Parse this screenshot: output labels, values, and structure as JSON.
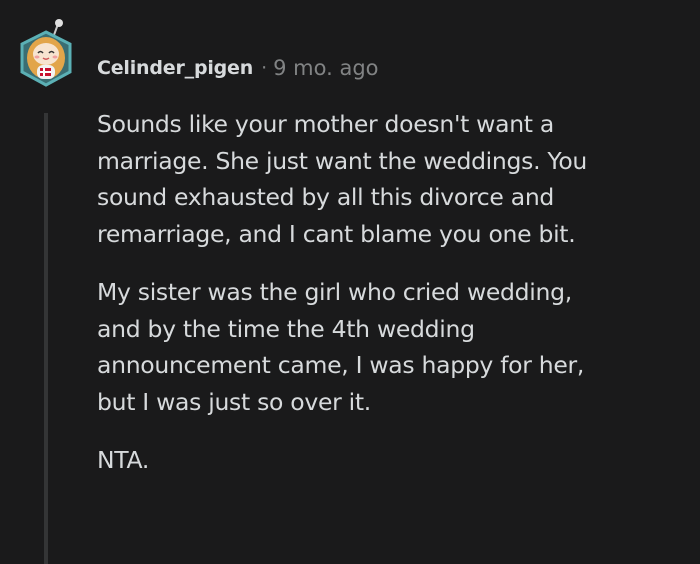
{
  "comment": {
    "username": "Celinder_pigen",
    "separator": "·",
    "time": "9 mo. ago",
    "paragraphs": [
      {
        "lines": [
          "Sounds like your mother doesn't want a",
          "marriage. She just want the weddings. You",
          "sound exhausted by all this divorce and",
          "remarriage, and I cant blame you one bit."
        ]
      },
      {
        "lines": [
          "My sister was the girl who cried wedding,",
          "and by the time the 4th wedding",
          "announcement came, I was happy for her,",
          "but I was just so over it."
        ]
      },
      {
        "lines": [
          "NTA."
        ]
      }
    ]
  },
  "colors": {
    "background": "#1a1a1b",
    "text": "#d7dadc",
    "muted": "#818384",
    "thread_line": "#343536",
    "avatar_ring": "#4a9a9e"
  },
  "avatar": {
    "icon": "snoo-avatar-icon"
  }
}
